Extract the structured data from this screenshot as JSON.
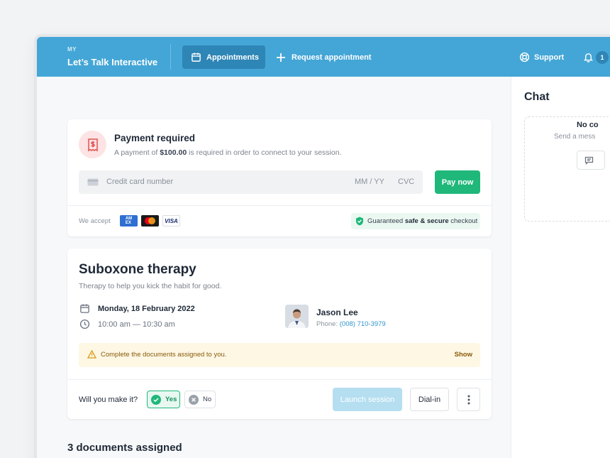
{
  "header": {
    "brand_small": "MY",
    "brand": "Let’s Talk Interactive",
    "nav": {
      "appointments": "Appointments",
      "request": "Request appointment",
      "support": "Support",
      "notifications_count": "1"
    }
  },
  "payment": {
    "title": "Payment required",
    "desc_prefix": "A payment of ",
    "amount": "$100.00",
    "desc_suffix": " is required in order to connect to your session.",
    "card_number_placeholder": "Credit card number",
    "expiry_placeholder": "MM / YY",
    "cvc_placeholder": "CVC",
    "pay_button": "Pay now",
    "accept_label": "We accept",
    "card_logos": [
      "AMEX",
      "Mastercard",
      "VISA"
    ],
    "secure_prefix": "Guaranteed ",
    "secure_bold": "safe & secure",
    "secure_suffix": " checkout"
  },
  "appointment": {
    "title": "Suboxone therapy",
    "subtitle": "Therapy to help you kick the habit for good.",
    "date": "Monday, 18 February 2022",
    "time": "10:00 am — 10:30 am",
    "doctor_name": "Jason Lee",
    "phone_label": "Phone: ",
    "phone": "(008) 710-3979",
    "warning": "Complete the documents assigned to you.",
    "warning_action": "Show",
    "rsvp_question": "Will you make it?",
    "rsvp_yes": "Yes",
    "rsvp_no": "No",
    "launch_button": "Launch session",
    "dialin_button": "Dial-in"
  },
  "documents": {
    "heading": "3 documents assigned"
  },
  "chat": {
    "title": "Chat",
    "empty_title": "No co",
    "empty_sub": "Send a mess"
  },
  "colors": {
    "primary": "#44a6d6",
    "primary_dark": "#2e86b6",
    "success": "#1fb87a",
    "warning_bg": "#fdf7e4"
  }
}
